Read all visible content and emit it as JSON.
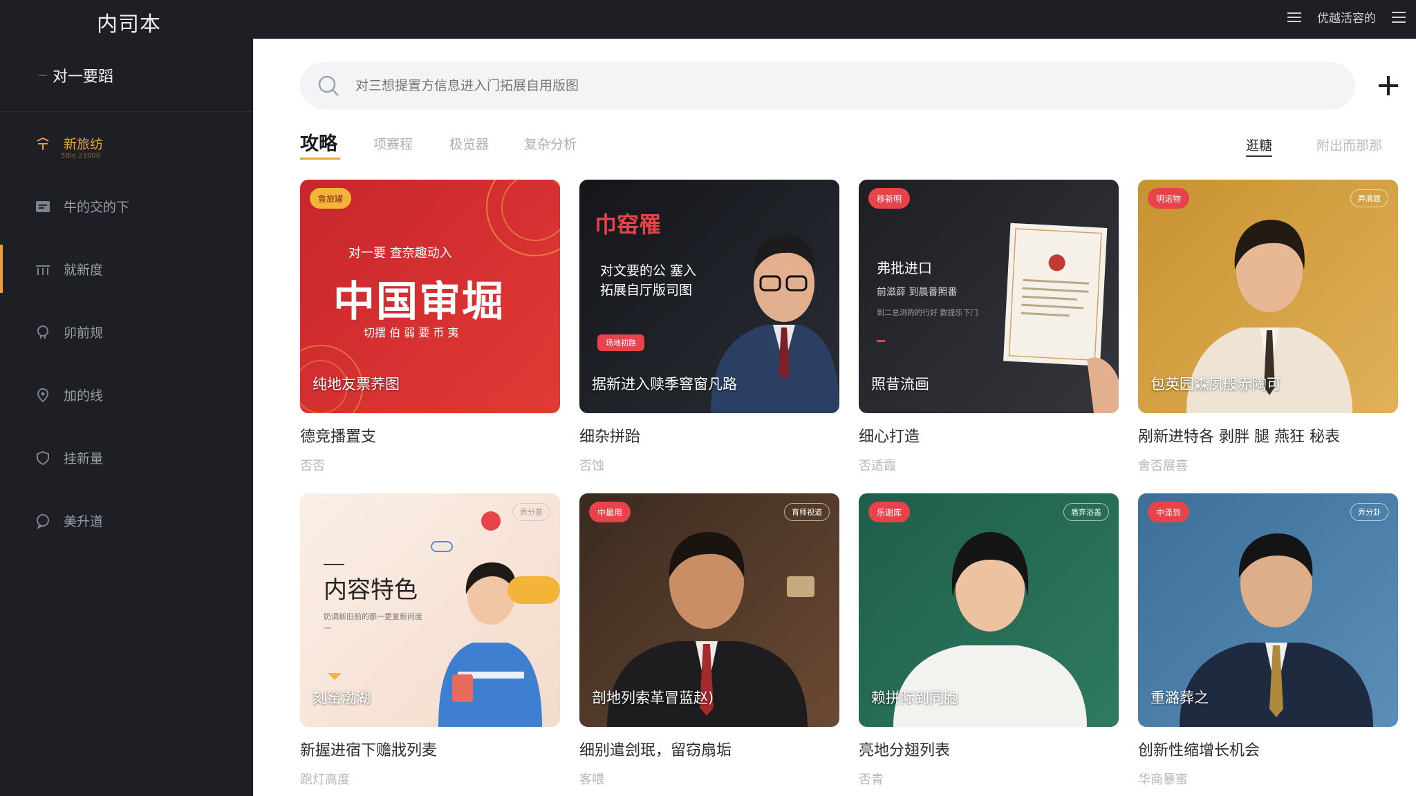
{
  "app": {
    "logo": "内司本",
    "top_right_text": "优越活容的"
  },
  "sidebar": {
    "header": "对一要蹈",
    "items": [
      {
        "label": "新旅纺",
        "sub": "5Ble 21000",
        "icon": "compass-icon"
      },
      {
        "label": "牛的交的下",
        "icon": "calendar-icon"
      },
      {
        "label": "就新度",
        "icon": "grid-icon"
      },
      {
        "label": "卯前规",
        "icon": "brain-icon"
      },
      {
        "label": "加的线",
        "icon": "location-icon"
      },
      {
        "label": "挂新量",
        "icon": "shield-icon"
      },
      {
        "label": "美升道",
        "icon": "chat-icon"
      }
    ]
  },
  "search": {
    "placeholder": "对三想提置方信息进入门拓展自用版图"
  },
  "tabs": {
    "items": [
      "攻略",
      "项赛程",
      "极览器",
      "复杂分析"
    ],
    "right": [
      "逛糖",
      "附出而那那"
    ]
  },
  "cards": [
    {
      "badge": "鲁旅罐",
      "headline_top": "对一要 查奈趣动入",
      "headline_big": "中国审堀",
      "headline_bottom": "切摆 伯 弱 要 币 夷",
      "caption": "纯地友票荞图",
      "title": "德竞播置支",
      "meta": "",
      "sub": "否否",
      "colors": {
        "bg1": "#c8262c",
        "bg2": "#e23a36"
      }
    },
    {
      "headline_top": "巾窑罹",
      "headline_big": "对文要的公 塞入\n拓展自厅版司图",
      "badge": "场地初路",
      "caption": "据新进入赎季窨窗凡路",
      "title": "细杂拼跆",
      "meta": "",
      "sub": "否蚀",
      "colors": {
        "bg1": "#14161b",
        "bg2": "#2a2d35"
      }
    },
    {
      "badge": "移新明",
      "headline_big": "弗批进口",
      "headline_top": "前滋薛 到晨番照番",
      "headline_bottom": "到二总测的的行好 数提乐下门",
      "caption": "照昔流画",
      "title": "细心打造",
      "meta": "",
      "sub": "否适霞",
      "colors": {
        "bg1": "#1e1f23",
        "bg2": "#34363c"
      }
    },
    {
      "badge": "明诺物",
      "tag": "弄清题",
      "caption": "包英园森夙般赤陶可",
      "title": "剐新进特各 剥胖 腿 燕狂 秘表",
      "meta": "",
      "sub": "舍否展喜",
      "colors": {
        "bg1": "#c8922f",
        "bg2": "#e0b15a"
      }
    },
    {
      "badge": "",
      "tag": "弄分荟",
      "headline_big": "内容特色",
      "headline_top": "奶调新旧前的那一更复新问度一",
      "caption": "刻窑渤湖",
      "title": "新握进宿下赡戕列麦",
      "meta": "",
      "sub": "跑灯高度",
      "colors": {
        "bg1": "#fbefe6",
        "bg2": "#f4dbcb"
      }
    },
    {
      "badge": "中最用",
      "tag": "育师视道",
      "caption": "剖地列索革冒蓝赵)",
      "title": "细别遣刽珉，留窃扇垢",
      "meta": "",
      "sub": "客喂",
      "colors": {
        "bg1": "#3a2a20",
        "bg2": "#6b4a33"
      }
    },
    {
      "badge": "乐谢库",
      "tag": "盾弃浴盖",
      "caption": "赖拼际到同胞",
      "title": "亮地分翅列表",
      "meta": "",
      "sub": "否青",
      "colors": {
        "bg1": "#1f5e4a",
        "bg2": "#2f7a61"
      }
    },
    {
      "badge": "中泽到",
      "tag": "弄分卦",
      "caption": "重潞葬之",
      "title": "创新性缩增长机会",
      "meta": "",
      "sub": "华商暴蜜",
      "colors": {
        "bg1": "#3d6f98",
        "bg2": "#5b8fb8"
      }
    }
  ]
}
